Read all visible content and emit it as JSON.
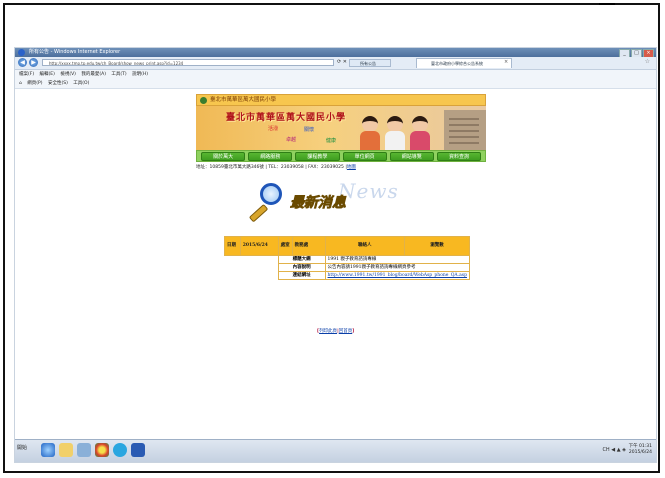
{
  "browser": {
    "window_title": "所有公告 - Windows Internet Explorer",
    "address": "http://xxxx.tmp.tp.edu.tw/ch_Board/show_news_print.asp?id=1234",
    "tab_inactive": "所有公告",
    "tab_active": "臺北市政府小學綜合公告系統",
    "menu": [
      "檔案(F)",
      "編輯(E)",
      "檢視(V)",
      "我的最愛(A)",
      "工具(T)",
      "說明(H)"
    ],
    "commands": [
      "網頁(P)",
      "安全性(S)",
      "工具(O)"
    ]
  },
  "site": {
    "school_header": "臺北市萬華區萬大國民小學",
    "banner_title": "臺北市萬華區萬大國民小學",
    "banner_words": [
      "活潑",
      "關懷",
      "卓越",
      "健康"
    ],
    "nav": [
      "關於萬大",
      "網路服務",
      "課程教學",
      "單位網頁",
      "網站導覽",
      "資料查詢"
    ],
    "address_line": "地址：10859臺北市萬大路346號 | TEL：23039058 | FAX：23039025 |",
    "map_link": "地圖",
    "news_bg": "News",
    "news_title": "最新消息"
  },
  "news": {
    "header": {
      "date_label": "日期",
      "date_value": "2015/6/24",
      "unit_label": "處室",
      "unit_value": "教務處",
      "contact_label": "聯絡人",
      "views_label": "瀏覽數"
    },
    "rows": [
      {
        "label": "標題大綱",
        "value": "1991 親子教育諮詢專線"
      },
      {
        "label": "內容說明",
        "value": "公告內容請1991親子教育諮詢專線網頁參考"
      },
      {
        "label": "連結網址",
        "value": "http://www.1991.tw/1991_blog/board/WebAsp_phone_QA.asp"
      }
    ]
  },
  "footer_links": {
    "prefix": "[",
    "print": "列印此頁",
    "separator": "|",
    "back": "回首頁",
    "suffix": "]"
  },
  "taskbar": {
    "start": "開始",
    "tray": "CH ◀ ▲ ◈",
    "time": "下午 01:31",
    "date": "2015/6/24"
  }
}
